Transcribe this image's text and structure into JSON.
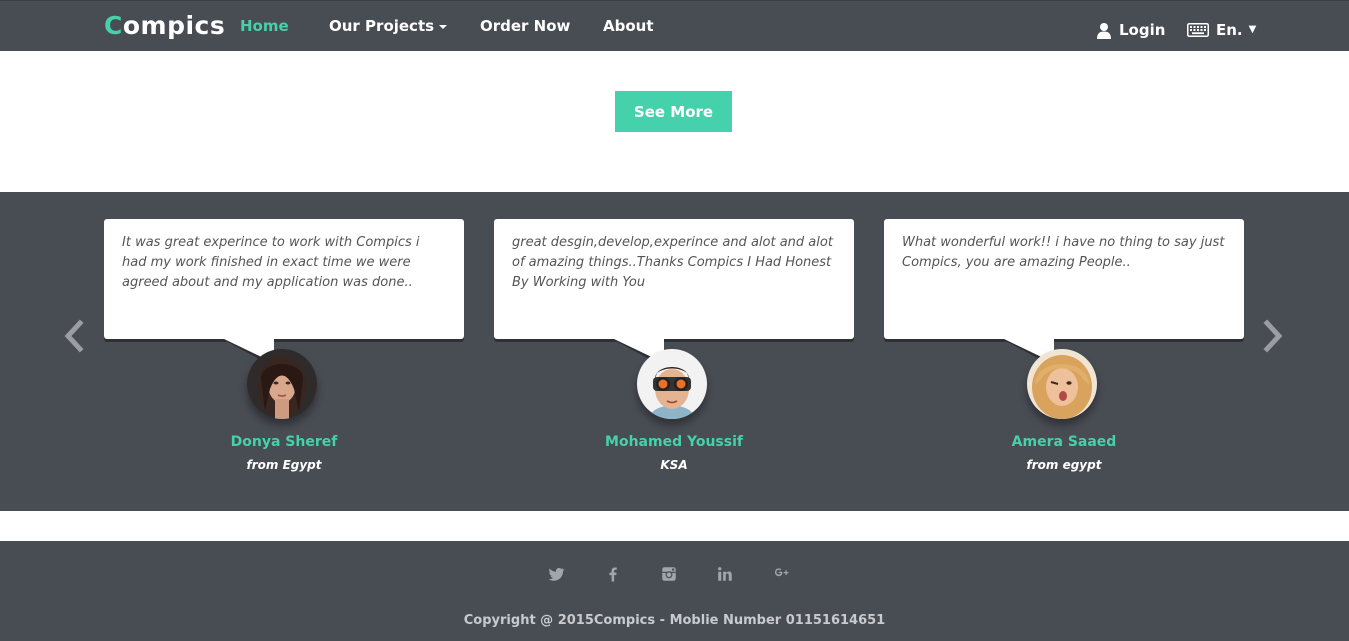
{
  "navbar": {
    "brand_first": "C",
    "brand_rest": "ompics",
    "items": [
      {
        "label": "Home"
      },
      {
        "label": "Our Projects"
      },
      {
        "label": "Order Now"
      },
      {
        "label": "About"
      }
    ],
    "login_label": "Login",
    "language_label": "En."
  },
  "hero": {
    "see_more_label": "See More"
  },
  "testimonials": [
    {
      "text": "It was great experince to work with Compics i had my work finished in exact time we were agreed about and my application was done..",
      "name": "Donya Sheref",
      "from": "from Egypt"
    },
    {
      "text": "great desgin,develop,experince and alot and alot of amazing things..Thanks Compics I Had Honest By Working with You",
      "name": "Mohamed Youssif",
      "from": "KSA"
    },
    {
      "text": "What wonderful work!! i have no thing to say just Compics, you are amazing People..",
      "name": "Amera Saaed",
      "from": "from egypt"
    }
  ],
  "footer": {
    "social_icons": [
      "twitter-icon",
      "facebook-icon",
      "instagram-icon",
      "linkedin-icon",
      "google-plus-icon"
    ],
    "copyright": "Copyright @ 2015Compics - Moblie Number 01151614651"
  },
  "colors": {
    "accent": "#45d1ab",
    "dark": "#484c53"
  }
}
